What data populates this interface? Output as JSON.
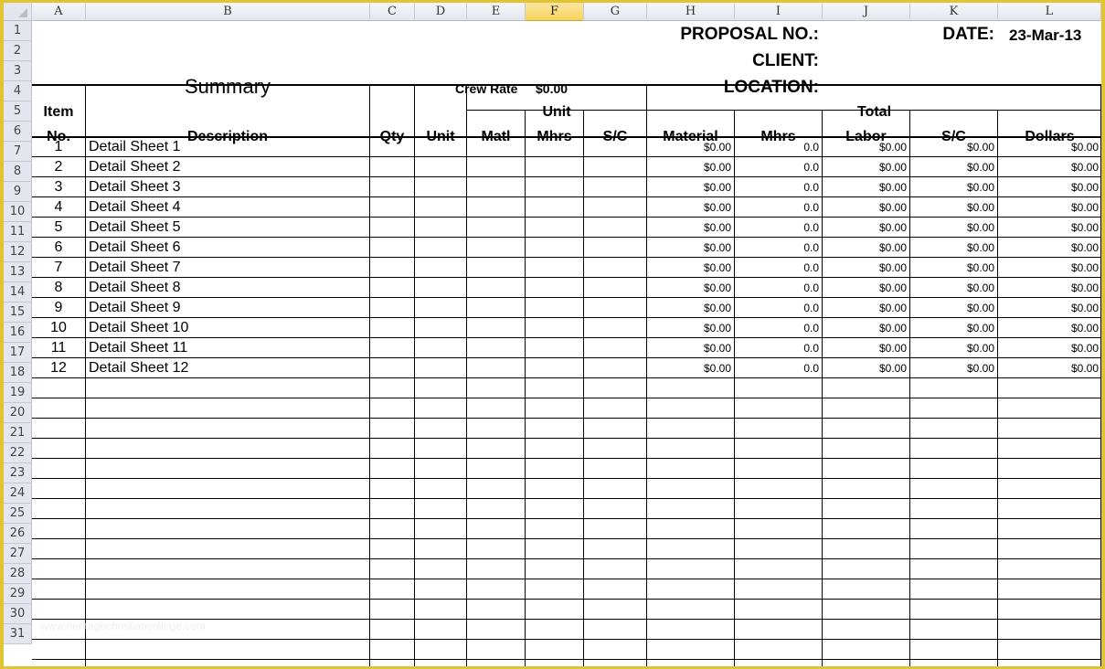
{
  "app": {
    "type": "spreadsheet",
    "accent_color": "#e0c434",
    "selected_column": "F"
  },
  "columns": [
    "A",
    "B",
    "C",
    "D",
    "E",
    "F",
    "G",
    "H",
    "I",
    "J",
    "K",
    "L"
  ],
  "rows": [
    "1",
    "2",
    "3",
    "4",
    "5",
    "6",
    "7",
    "8",
    "9",
    "10",
    "11",
    "12",
    "13",
    "14",
    "15",
    "16",
    "17",
    "18",
    "19",
    "20",
    "21",
    "22",
    "23",
    "24",
    "25",
    "26",
    "27",
    "28",
    "29",
    "30",
    "31"
  ],
  "header": {
    "title": "Summary",
    "crew_rate_label": "Crew Rate",
    "crew_rate_value": "$0.00",
    "proposal_label": "PROPOSAL NO.:",
    "proposal_value": "",
    "date_label": "DATE:",
    "date_value": "23-Mar-13",
    "client_label": "CLIENT:",
    "client_value": "",
    "location_label": "LOCATION:",
    "location_value": ""
  },
  "table": {
    "item_label_1": "Item",
    "item_label_2": "No.",
    "description": "Description",
    "qty": "Qty",
    "unit": "Unit",
    "unit_group": "Unit",
    "unit_matl": "Matl",
    "unit_mhrs": "Mhrs",
    "unit_sc": "S/C",
    "total_group": "Total",
    "total_material": "Material",
    "total_mhrs": "Mhrs",
    "total_labor": "Labor",
    "total_sc": "S/C",
    "total_dollars": "Dollars",
    "rows": [
      {
        "no": "1",
        "desc": "Detail Sheet 1",
        "material": "$0.00",
        "mhrs": "0.0",
        "labor": "$0.00",
        "sc": "$0.00",
        "dollars": "$0.00"
      },
      {
        "no": "2",
        "desc": "Detail Sheet 2",
        "material": "$0.00",
        "mhrs": "0.0",
        "labor": "$0.00",
        "sc": "$0.00",
        "dollars": "$0.00"
      },
      {
        "no": "3",
        "desc": "Detail Sheet 3",
        "material": "$0.00",
        "mhrs": "0.0",
        "labor": "$0.00",
        "sc": "$0.00",
        "dollars": "$0.00"
      },
      {
        "no": "4",
        "desc": "Detail Sheet 4",
        "material": "$0.00",
        "mhrs": "0.0",
        "labor": "$0.00",
        "sc": "$0.00",
        "dollars": "$0.00"
      },
      {
        "no": "5",
        "desc": "Detail Sheet 5",
        "material": "$0.00",
        "mhrs": "0.0",
        "labor": "$0.00",
        "sc": "$0.00",
        "dollars": "$0.00"
      },
      {
        "no": "6",
        "desc": "Detail Sheet 6",
        "material": "$0.00",
        "mhrs": "0.0",
        "labor": "$0.00",
        "sc": "$0.00",
        "dollars": "$0.00"
      },
      {
        "no": "7",
        "desc": "Detail Sheet 7",
        "material": "$0.00",
        "mhrs": "0.0",
        "labor": "$0.00",
        "sc": "$0.00",
        "dollars": "$0.00"
      },
      {
        "no": "8",
        "desc": "Detail Sheet 8",
        "material": "$0.00",
        "mhrs": "0.0",
        "labor": "$0.00",
        "sc": "$0.00",
        "dollars": "$0.00"
      },
      {
        "no": "9",
        "desc": "Detail Sheet 9",
        "material": "$0.00",
        "mhrs": "0.0",
        "labor": "$0.00",
        "sc": "$0.00",
        "dollars": "$0.00"
      },
      {
        "no": "10",
        "desc": "Detail Sheet 10",
        "material": "$0.00",
        "mhrs": "0.0",
        "labor": "$0.00",
        "sc": "$0.00",
        "dollars": "$0.00"
      },
      {
        "no": "11",
        "desc": "Detail Sheet 11",
        "material": "$0.00",
        "mhrs": "0.0",
        "labor": "$0.00",
        "sc": "$0.00",
        "dollars": "$0.00"
      },
      {
        "no": "12",
        "desc": "Detail Sheet 12",
        "material": "$0.00",
        "mhrs": "0.0",
        "labor": "$0.00",
        "sc": "$0.00",
        "dollars": "$0.00"
      }
    ]
  },
  "watermark": "www.heritagechristiancollege.com"
}
